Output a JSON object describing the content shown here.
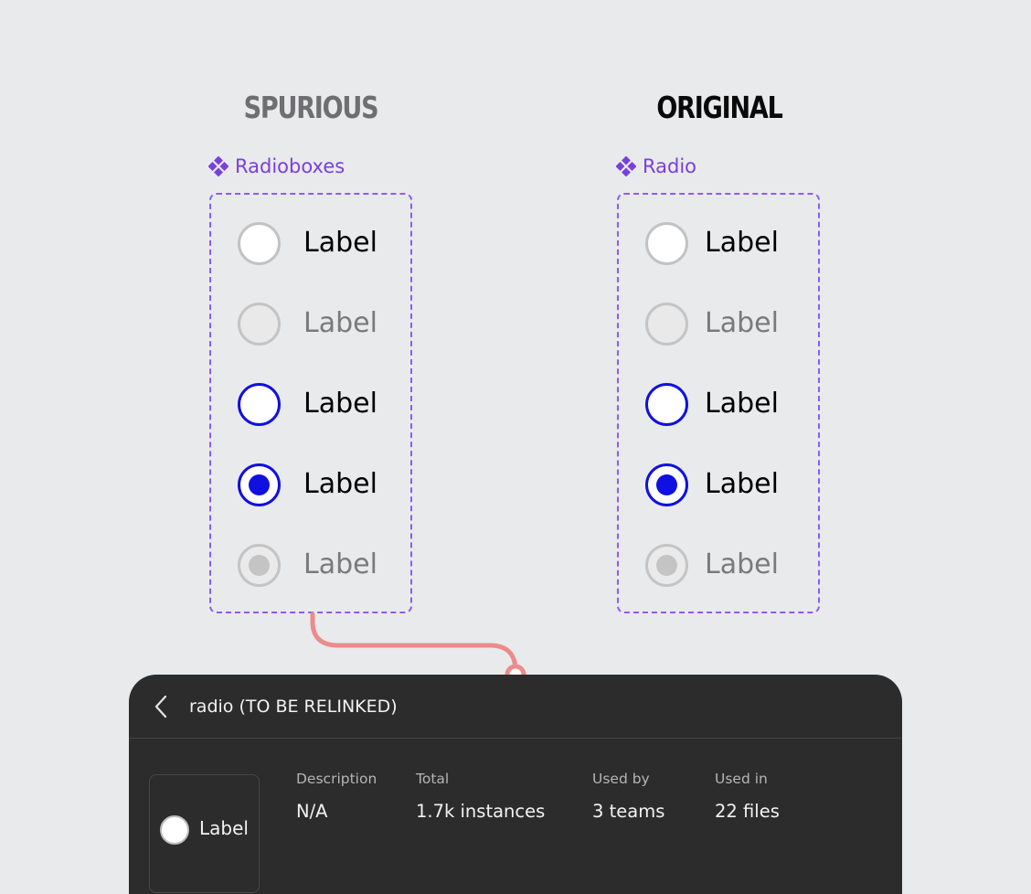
{
  "columns": {
    "spurious": {
      "title": "SPURIOUS",
      "component_name": "Radioboxes",
      "radios": [
        {
          "state": "default",
          "label": "Label"
        },
        {
          "state": "disabled",
          "label": "Label"
        },
        {
          "state": "focus",
          "label": "Label"
        },
        {
          "state": "checked",
          "label": "Label"
        },
        {
          "state": "checked-disabled",
          "label": "Label"
        }
      ]
    },
    "original": {
      "title": "ORIGINAL",
      "component_name": "Radio",
      "radios": [
        {
          "state": "default",
          "label": "Label"
        },
        {
          "state": "disabled",
          "label": "Label"
        },
        {
          "state": "focus",
          "label": "Label"
        },
        {
          "state": "checked",
          "label": "Label"
        },
        {
          "state": "checked-disabled",
          "label": "Label"
        }
      ]
    }
  },
  "icons": {
    "component": "component-diamond-icon",
    "back": "chevron-left-icon"
  },
  "colors": {
    "accent": "#1010e0",
    "component_purple": "#7b3fdc",
    "connector": "#ec8b8b",
    "panel_bg": "#2c2c2c"
  },
  "inspector": {
    "title": "radio (TO BE RELINKED)",
    "preview_label": "Label",
    "stats": {
      "description": {
        "label": "Description",
        "value": "N/A"
      },
      "total": {
        "label": "Total",
        "value": "1.7k instances"
      },
      "used_by": {
        "label": "Used by",
        "value": "3 teams"
      },
      "used_in": {
        "label": "Used in",
        "value": "22 files"
      }
    }
  }
}
